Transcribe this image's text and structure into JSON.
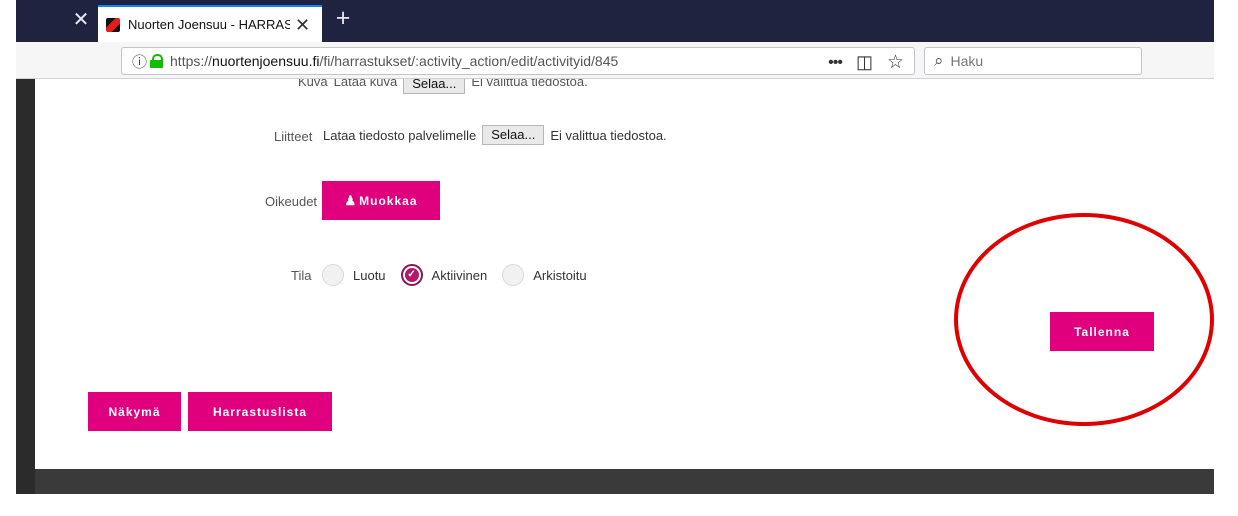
{
  "browser": {
    "tab_close": "✕",
    "active_tab_title": "Nuorten Joensuu - HARRASTUS",
    "active_tab_close": "✕",
    "new_tab": "+",
    "url_prefix": "https://",
    "url_domain": "nuortenjoensuu.fi",
    "url_path": "/fi/harrastukset/:activity_action/edit/activityid/845",
    "page_actions": "•••",
    "pocket_icon": "◫",
    "bookmark_icon": "☆",
    "search_placeholder": "Haku",
    "search_icon": "⌕"
  },
  "form": {
    "kuva": {
      "label": "Kuva",
      "upload_text": "Lataa kuva",
      "browse": "Selaa...",
      "status": "Ei valittua tiedostoa."
    },
    "liitteet": {
      "label": "Liitteet",
      "upload_text": "Lataa tiedosto palvelimelle",
      "browse": "Selaa...",
      "status": "Ei valittua tiedostoa."
    },
    "oikeudet": {
      "label": "Oikeudet",
      "button": "Muokkaa",
      "icon": "users-icon"
    },
    "tila": {
      "label": "Tila",
      "options": [
        "Luotu",
        "Aktiivinen",
        "Arkistoitu"
      ],
      "selected": "Aktiivinen"
    },
    "buttons": {
      "save": "Tallenna",
      "view": "Näkymä",
      "list": "Harrastuslista"
    }
  },
  "colors": {
    "brand_pink": "#e0007d",
    "annotation_red": "#e00000",
    "tab_bar": "#202340"
  }
}
